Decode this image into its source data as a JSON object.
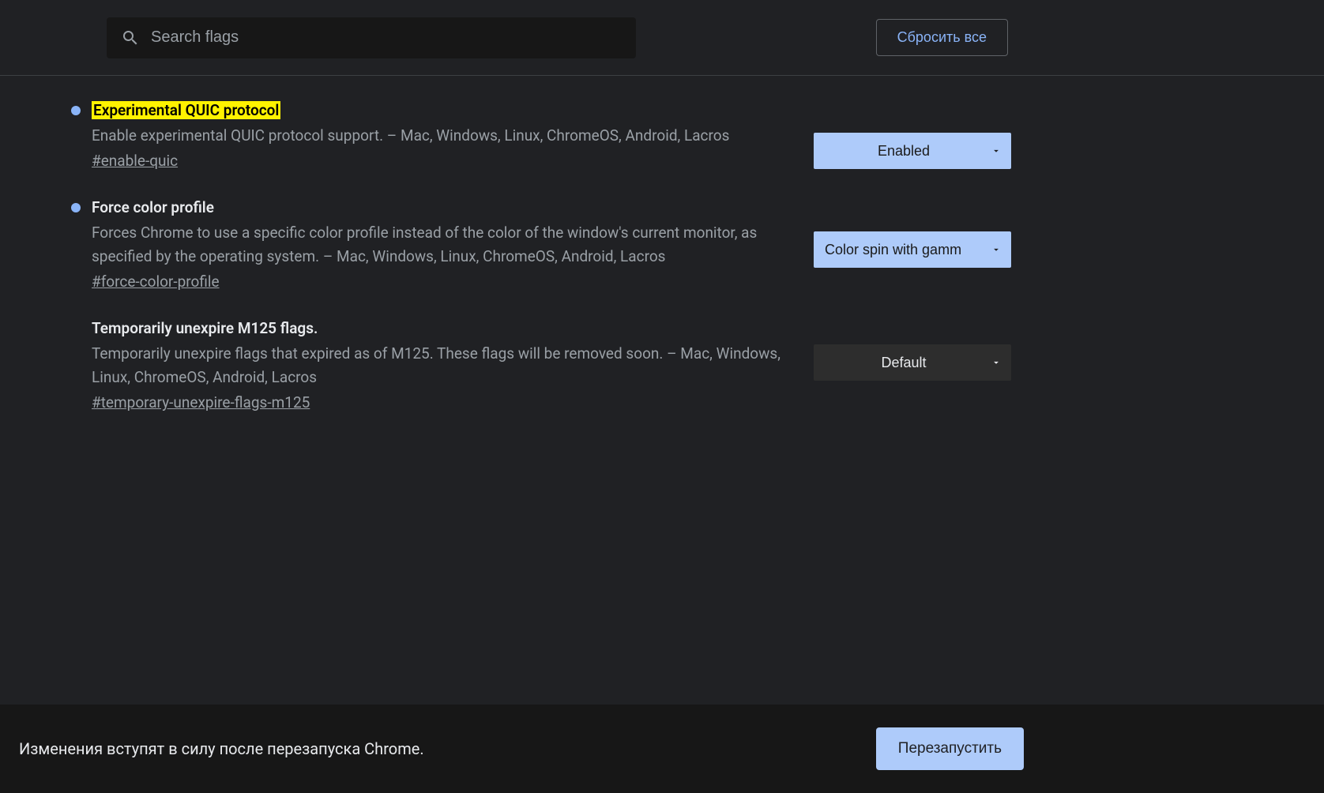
{
  "header": {
    "search_placeholder": "Search flags",
    "reset_label": "Сбросить все"
  },
  "flags": [
    {
      "title": "Experimental QUIC protocol",
      "description": "Enable experimental QUIC protocol support. – Mac, Windows, Linux, ChromeOS, Android, Lacros",
      "anchor": "#enable-quic",
      "selected": "Enabled",
      "modified": true,
      "highlight": true
    },
    {
      "title": "Force color profile",
      "description": "Forces Chrome to use a specific color profile instead of the color of the window's current monitor, as specified by the operating system. – Mac, Windows, Linux, ChromeOS, Android, Lacros",
      "anchor": "#force-color-profile",
      "selected": "Color spin with gamm",
      "modified": true,
      "highlight": false
    },
    {
      "title": "Temporarily unexpire M125 flags.",
      "description": "Temporarily unexpire flags that expired as of M125. These flags will be removed soon. – Mac, Windows, Linux, ChromeOS, Android, Lacros",
      "anchor": "#temporary-unexpire-flags-m125",
      "selected": "Default",
      "modified": false,
      "highlight": false
    }
  ],
  "footer": {
    "message": "Изменения вступят в силу после перезапуска Chrome.",
    "relaunch_label": "Перезапустить"
  }
}
